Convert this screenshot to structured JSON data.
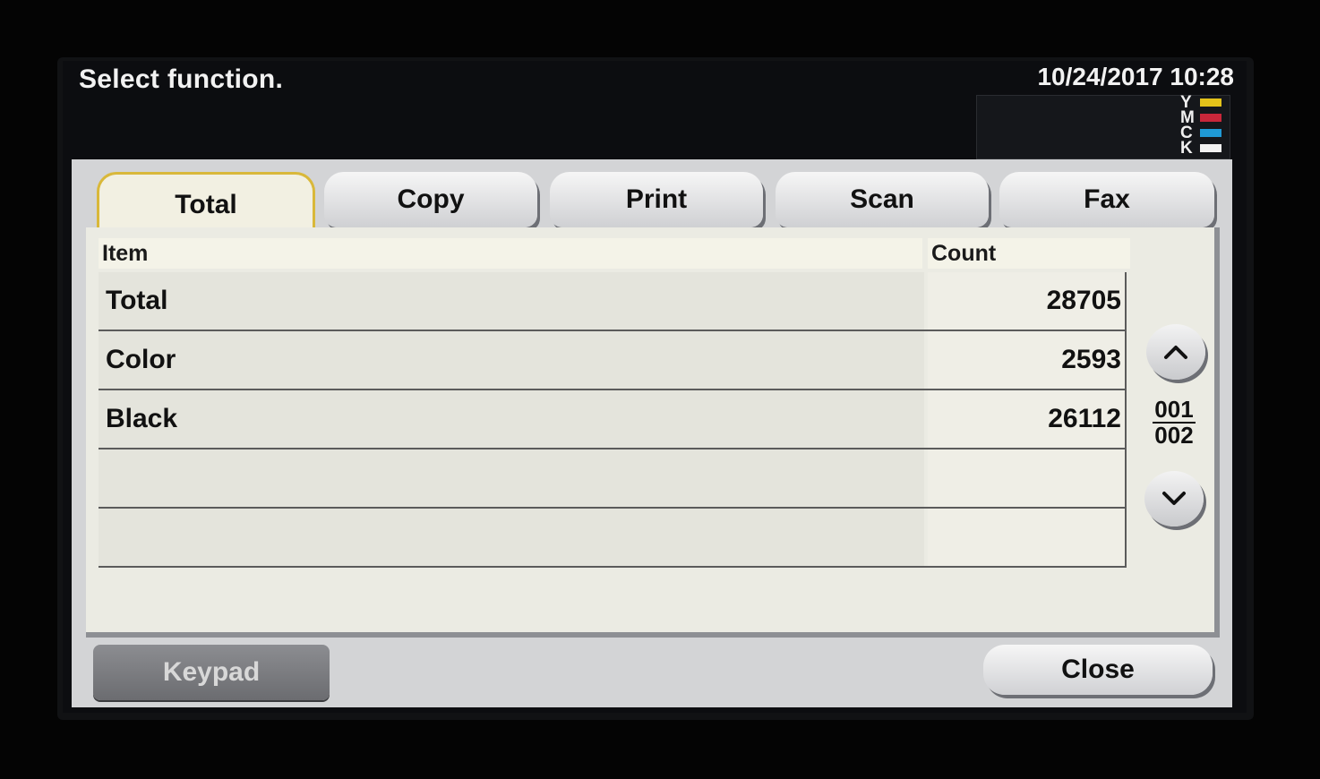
{
  "header": {
    "message": "Select function.",
    "datetime": "10/24/2017 10:28"
  },
  "toner": [
    {
      "letter": "Y",
      "color": "#e3c21a"
    },
    {
      "letter": "M",
      "color": "#c8273a"
    },
    {
      "letter": "C",
      "color": "#1f9ad6"
    },
    {
      "letter": "K",
      "color": "#f2f2f2"
    }
  ],
  "tabs": [
    {
      "label": "Total",
      "active": true
    },
    {
      "label": "Copy",
      "active": false
    },
    {
      "label": "Print",
      "active": false
    },
    {
      "label": "Scan",
      "active": false
    },
    {
      "label": "Fax",
      "active": false
    }
  ],
  "table": {
    "headers": {
      "item": "Item",
      "count": "Count"
    },
    "rows": [
      {
        "item": "Total",
        "count": "28705"
      },
      {
        "item": "Color",
        "count": "2593"
      },
      {
        "item": "Black",
        "count": "26112"
      },
      {
        "item": "",
        "count": ""
      },
      {
        "item": "",
        "count": ""
      }
    ]
  },
  "pager": {
    "current": "001",
    "total": "002"
  },
  "buttons": {
    "keypad": "Keypad",
    "close": "Close"
  },
  "icons": {
    "scroll_up": "chevron-up-icon",
    "scroll_down": "chevron-down-icon"
  }
}
